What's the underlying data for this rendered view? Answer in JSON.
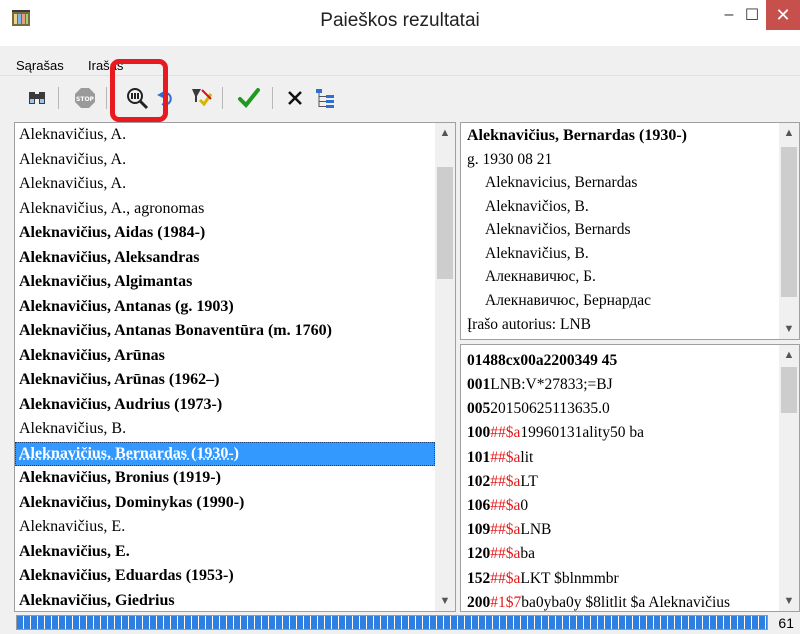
{
  "window": {
    "title": "Paieškos rezultatai",
    "min_glyph": "–",
    "max_glyph": "☐",
    "close_glyph": "✕"
  },
  "menu": {
    "items": [
      "Sąrašas",
      "Irašas"
    ]
  },
  "toolbar": {
    "buttons": [
      "binoculars-icon",
      "stop-icon",
      "search-record-icon",
      "undo-icon",
      "filter-icon",
      "check-icon",
      "close-icon",
      "tree-icon"
    ],
    "stop_label": "STOP"
  },
  "list": {
    "selected_index": 13,
    "items": [
      {
        "text": "Aleknavičius, A.",
        "bold": false
      },
      {
        "text": "Aleknavičius, A.",
        "bold": false
      },
      {
        "text": "Aleknavičius, A.",
        "bold": false
      },
      {
        "text": "Aleknavičius, A., agronomas",
        "bold": false
      },
      {
        "text": "Aleknavičius, Aidas (1984-)",
        "bold": true
      },
      {
        "text": "Aleknavičius, Aleksandras",
        "bold": true
      },
      {
        "text": "Aleknavičius, Algimantas",
        "bold": true
      },
      {
        "text": "Aleknavičius, Antanas (g. 1903)",
        "bold": true
      },
      {
        "text": "Aleknavičius, Antanas Bonaventūra (m. 1760)",
        "bold": true
      },
      {
        "text": "Aleknavičius, Arūnas",
        "bold": true
      },
      {
        "text": "Aleknavičius, Arūnas (1962–)",
        "bold": true
      },
      {
        "text": "Aleknavičius, Audrius (1973-)",
        "bold": true
      },
      {
        "text": "Aleknavičius, B.",
        "bold": false
      },
      {
        "text": "Aleknavičius, Bernardas (1930-)",
        "bold": true
      },
      {
        "text": "Aleknavičius, Bronius (1919-)",
        "bold": true
      },
      {
        "text": "Aleknavičius, Dominykas (1990-)",
        "bold": true
      },
      {
        "text": "Aleknavičius, E.",
        "bold": false
      },
      {
        "text": "Aleknavičius, E.",
        "bold": true
      },
      {
        "text": "Aleknavičius, Eduardas (1953-)",
        "bold": true
      },
      {
        "text": "Aleknavičius, Giedrius",
        "bold": true
      }
    ]
  },
  "authority": {
    "title": "Aleknavičius, Bernardas (1930-)",
    "birth": "g. 1930 08 21",
    "variants": [
      "Aleknavicius, Bernardas",
      "Aleknavičios, B.",
      "Aleknavičios, Bernards",
      "Aleknavičius, B.",
      "Алекнавичюс, Б.",
      "Алекнавичюс, Бернардас"
    ],
    "author_line": "Įrašo autorius: LNB"
  },
  "marc": {
    "leader": "01488cx00a2200349   45",
    "fields": [
      {
        "tag": "001",
        "ind": "",
        "content": "LNB:V*27833;=BJ"
      },
      {
        "tag": "005",
        "ind": "",
        "content": "20150625113635.0"
      },
      {
        "tag": "100",
        "ind": "##",
        "sub": "$a",
        "content": "19960131ality50      ba"
      },
      {
        "tag": "101",
        "ind": "##",
        "sub": "$a",
        "content": "lit"
      },
      {
        "tag": "102",
        "ind": "##",
        "sub": "$a",
        "content": "LT"
      },
      {
        "tag": "106",
        "ind": "##",
        "sub": "$a",
        "content": "0"
      },
      {
        "tag": "109",
        "ind": "##",
        "sub": "$a",
        "content": "LNB"
      },
      {
        "tag": "120",
        "ind": "##",
        "sub": "$a",
        "content": "ba"
      },
      {
        "tag": "152",
        "ind": "##",
        "sub": "$a",
        "content": "LKT $blnmmbr"
      },
      {
        "tag": "200",
        "ind": "#1",
        "sub": "$7",
        "content": "ba0yba0y $8litlit $a Aleknavičius"
      }
    ]
  },
  "status": {
    "progress_fraction": 1.0,
    "count": "61"
  },
  "colors": {
    "selection": "#3399ff",
    "close_button": "#c7504c",
    "highlight": "#e8191f",
    "marc_red": "#e21a1a",
    "progress": "#2f7fe0"
  }
}
